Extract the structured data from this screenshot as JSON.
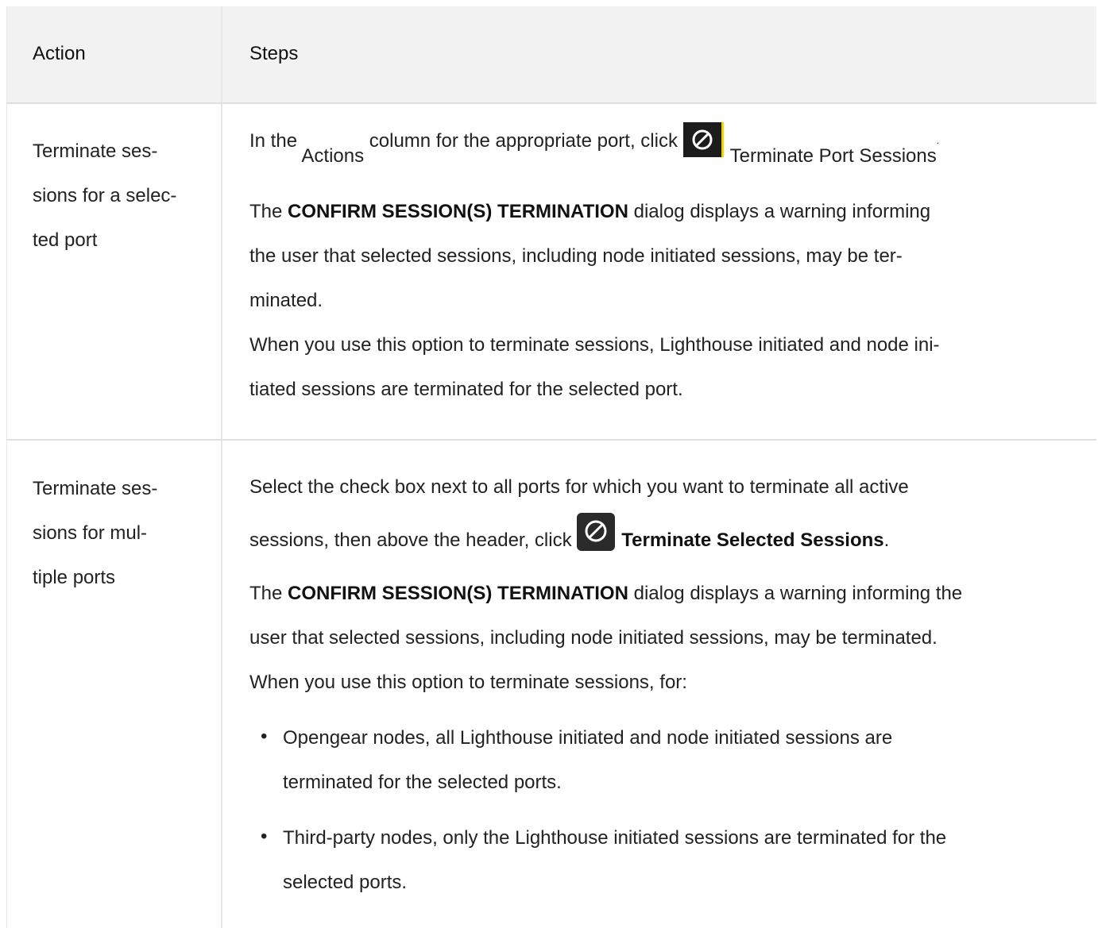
{
  "header": {
    "action": "Action",
    "steps": "Steps"
  },
  "rows": [
    {
      "action_lines": [
        "Terminate ses-",
        "sions for a selec-",
        "ted port"
      ],
      "step1": {
        "pre": "In the ",
        "actions": "Actions",
        "mid": " column for the appropriate port, click ",
        "icon": "block-icon",
        "label": "Terminate Port Sessions",
        "post": "."
      },
      "para1": [
        "The ",
        "CONFIRM SESSION(S) TERMINATION",
        " dialog displays a warning informing"
      ],
      "para1_l2": "the user that selected sessions, including node initiated sessions, may be ter-",
      "para1_l3": "minated.",
      "para2_l1": "When you use this option to terminate sessions, Lighthouse initiated and node ini-",
      "para2_l2": "tiated sessions are terminated for the selected port."
    },
    {
      "action_lines": [
        "Terminate ses-",
        "sions for mul-",
        "tiple ports"
      ],
      "step1_l1": "Select the check box next to all ports for which you want to terminate all active",
      "step1_l2": {
        "pre": "sessions, then above the header, click ",
        "icon": "block-icon",
        "label": "Terminate Selected Sessions",
        "post": "."
      },
      "para1": [
        "The ",
        "CONFIRM SESSION(S) TERMINATION",
        " dialog displays a warning informing the"
      ],
      "para1_l2": "user that selected sessions, including node initiated sessions, may be terminated.",
      "para2": "When you use this option to terminate sessions, for:",
      "bullets": [
        {
          "l1": "Opengear nodes, all Lighthouse initiated and node initiated sessions are",
          "l2": "terminated for the selected ports."
        },
        {
          "l1": "Third-party nodes, only the Lighthouse initiated sessions are terminated for the",
          "l2": "selected ports."
        }
      ]
    }
  ]
}
